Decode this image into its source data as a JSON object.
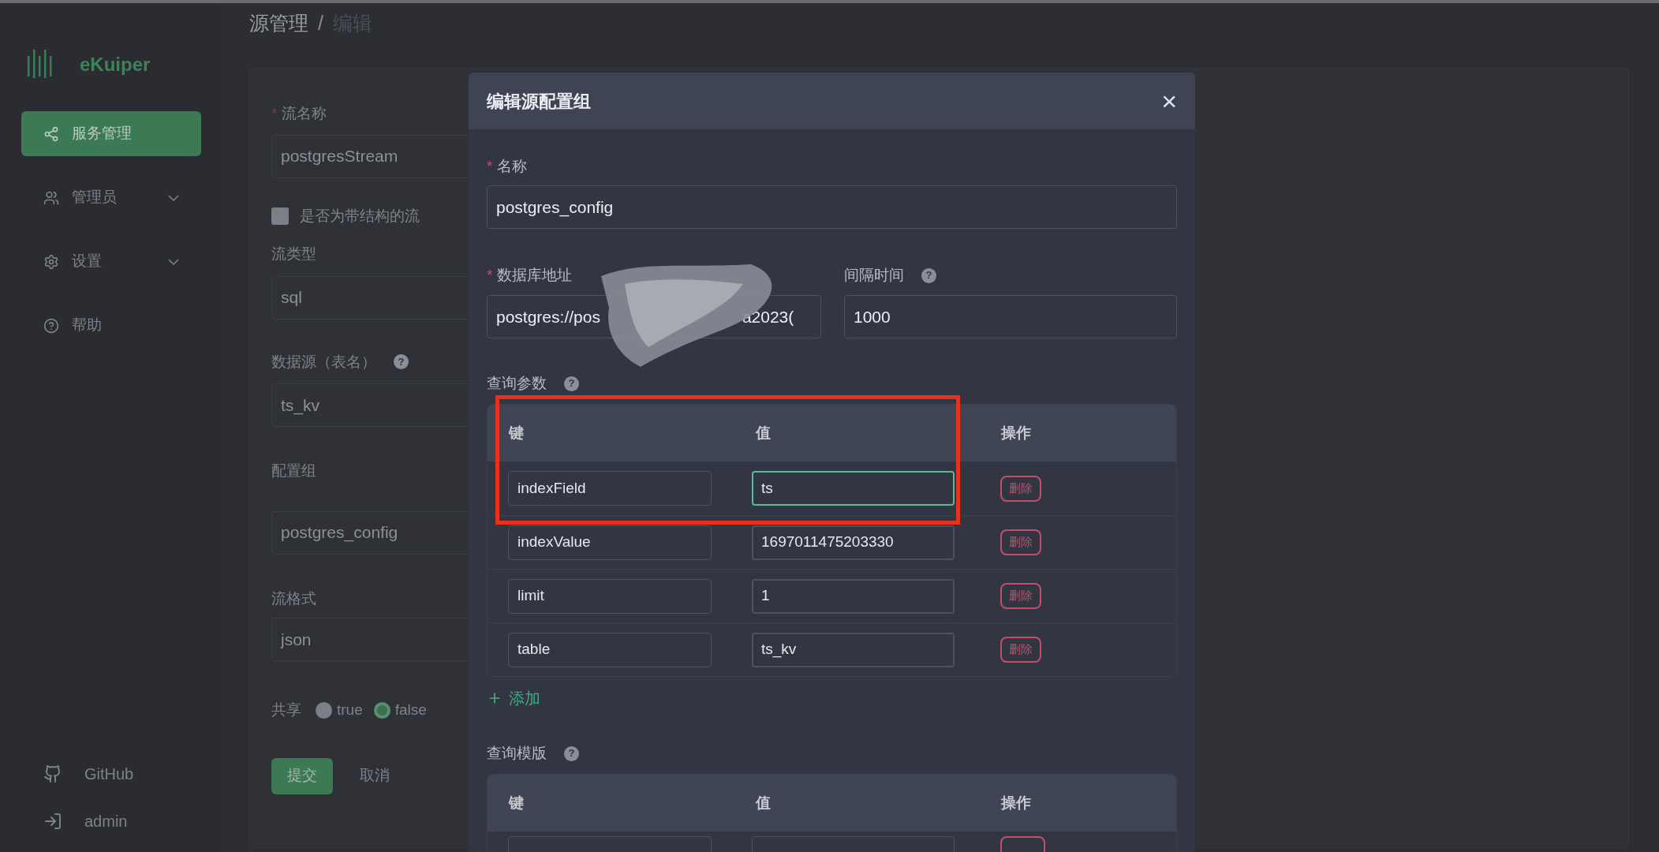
{
  "sidebar": {
    "logo_text": "eKuiper",
    "items": [
      {
        "label": "服务管理",
        "selected": true,
        "has_submenu": false
      },
      {
        "label": "管理员",
        "selected": false,
        "has_submenu": true
      },
      {
        "label": "设置",
        "selected": false,
        "has_submenu": true
      },
      {
        "label": "帮助",
        "selected": false,
        "has_submenu": false
      }
    ],
    "footer": [
      {
        "label": "GitHub"
      },
      {
        "label": "admin"
      }
    ]
  },
  "breadcrumb": [
    {
      "label": "源管理",
      "current": false
    },
    {
      "label": "编辑",
      "current": true
    }
  ],
  "breadcrumb_separator": "/",
  "stream_form": {
    "name_label": "流名称",
    "name_required_mark": "*",
    "help_mark": "?",
    "name_value": "postgresStream",
    "schema_checkbox": {
      "label": "是否为带结构的流",
      "checked": false
    },
    "type_label": "流类型",
    "type_value": "sql",
    "source_label": "数据源（表名）",
    "source_value": "ts_kv",
    "config_label": "配置组",
    "config_value": "postgres_config",
    "format_label": "流格式",
    "format_value": "json",
    "share_label": "共享",
    "share_options": [
      {
        "label": "true",
        "selected": false
      },
      {
        "label": "false",
        "selected": true
      }
    ],
    "submit": "提交",
    "cancel": "取消"
  },
  "dialog": {
    "title": "编辑源配置组",
    "close": "×",
    "name_label": "名称",
    "name_required_mark": "*",
    "help_mark": "?",
    "name_value": "postgres_config",
    "db_label": "数据库地址",
    "db_required_mark": "*",
    "db_value_start": "postgres://pos",
    "db_value_end": "a2023(",
    "interval_label": "间隔时间",
    "interval_value": "1000",
    "params_label": "查询参数",
    "params_columns": [
      "键",
      "值",
      "操作"
    ],
    "params_rows": [
      {
        "key": "indexField",
        "value": "ts",
        "focused": true,
        "action": "删除"
      },
      {
        "key": "indexValue",
        "value": "1697011475203330",
        "focused": false,
        "action": "删除"
      },
      {
        "key": "limit",
        "value": "1",
        "focused": false,
        "action": "删除"
      },
      {
        "key": "table",
        "value": "ts_kv",
        "focused": false,
        "action": "删除"
      }
    ],
    "add": "添加",
    "template_label": "查询模版",
    "template_columns": [
      "键",
      "值",
      "操作"
    ]
  }
}
